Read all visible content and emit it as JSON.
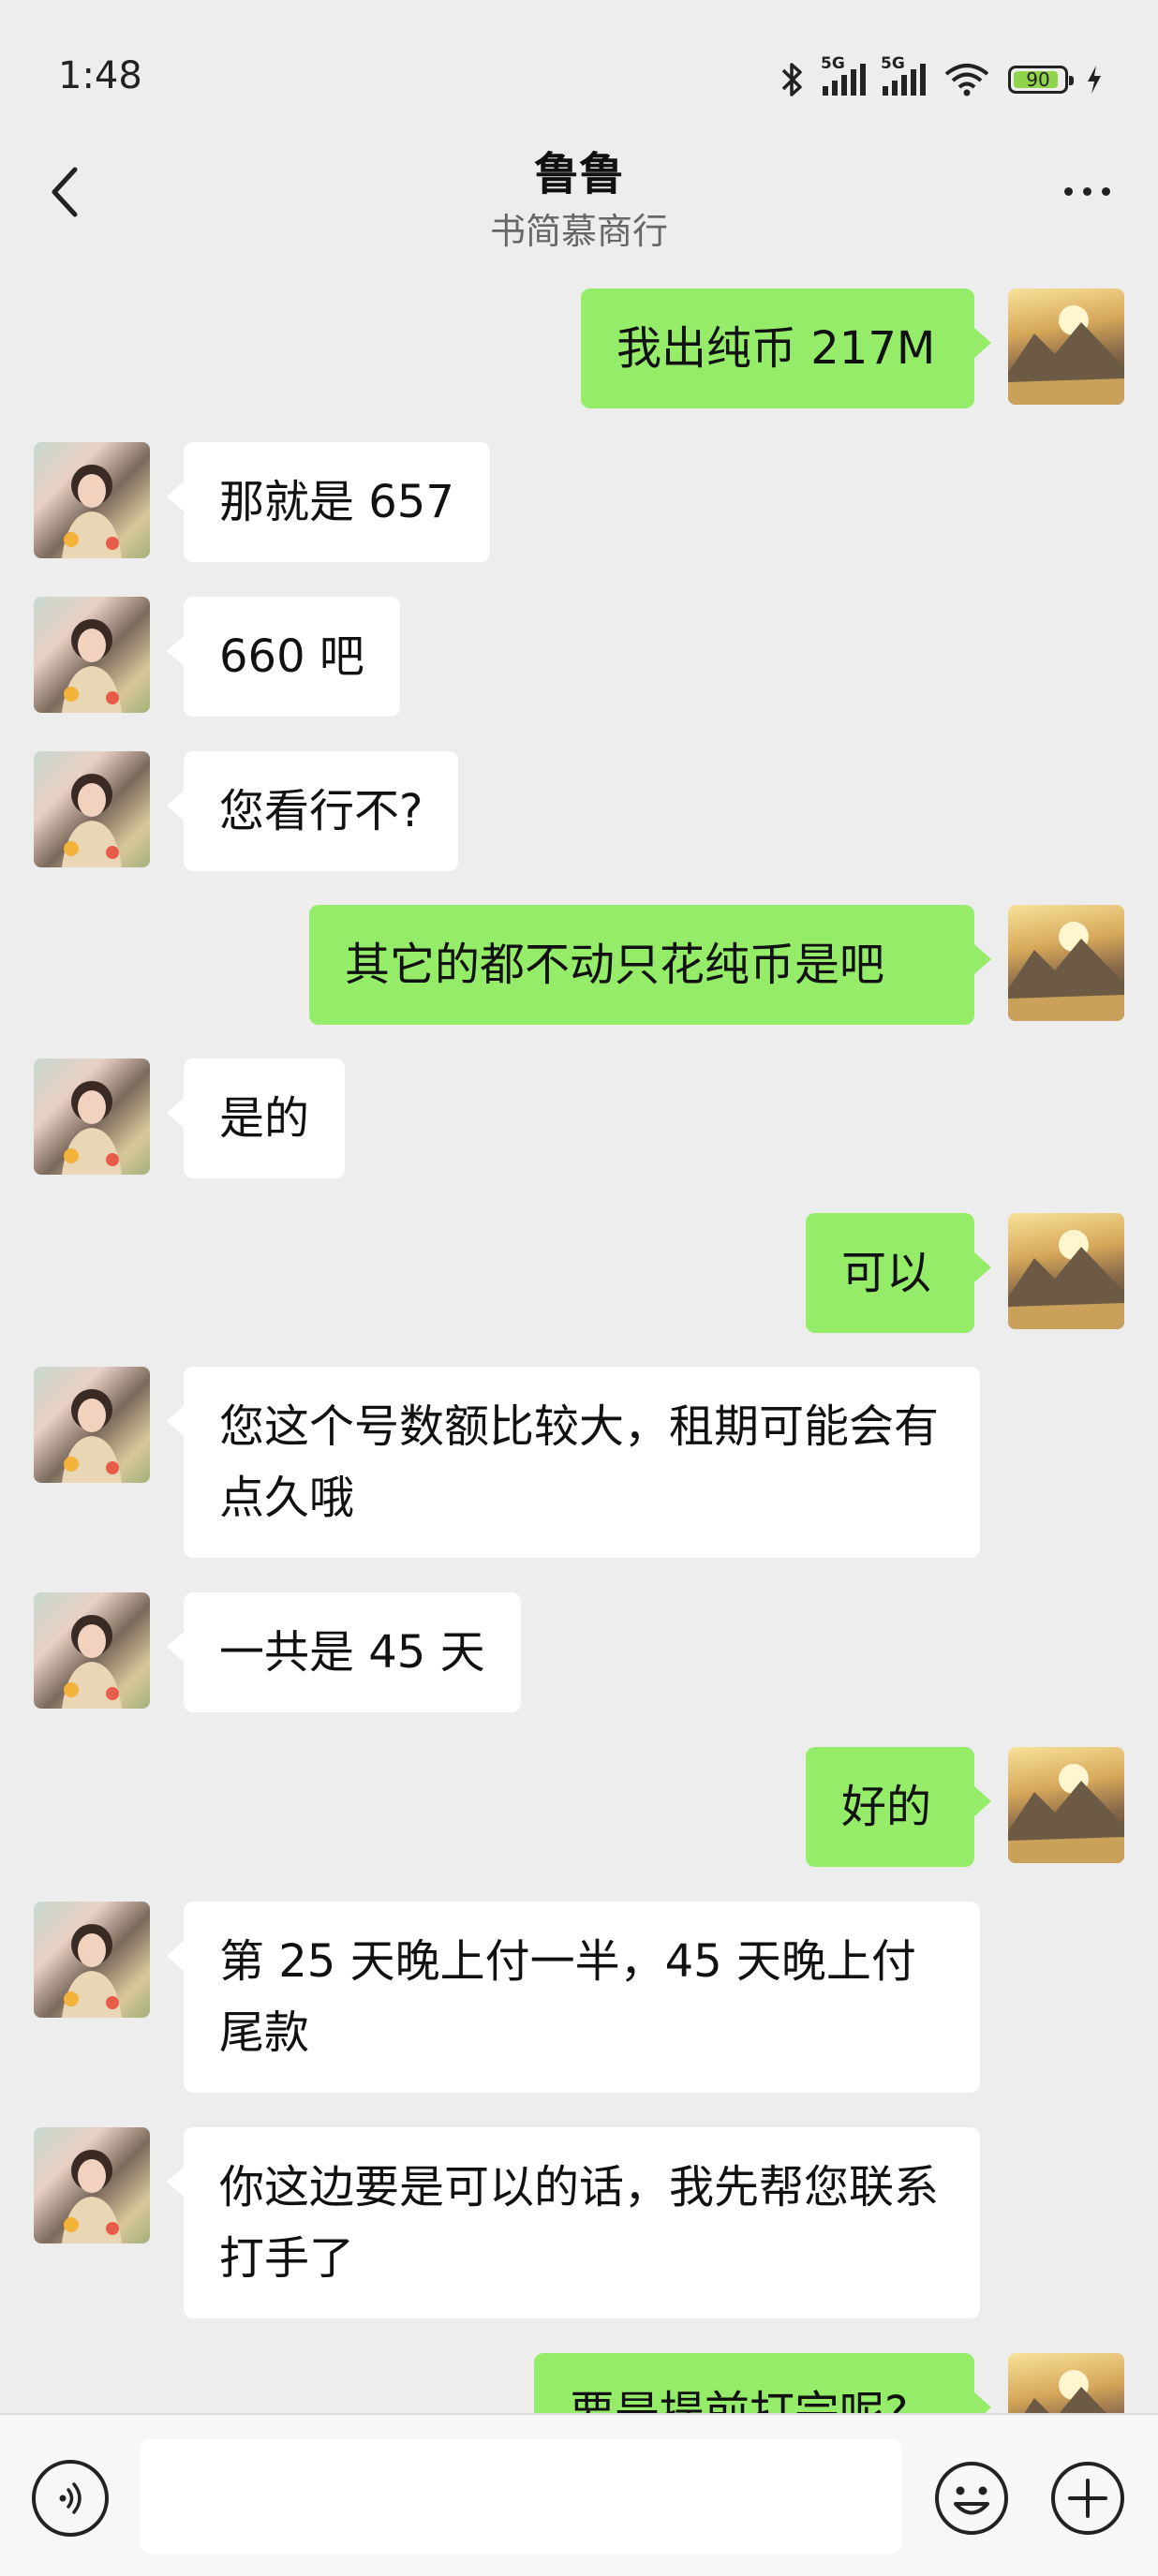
{
  "status": {
    "time": "1:48",
    "network1": "5G",
    "network2": "5G",
    "battery": "90",
    "battery_level": 0.9
  },
  "header": {
    "title": "鲁鲁",
    "subtitle": "书简慕商行"
  },
  "messages": [
    {
      "side": "out",
      "text": "我出纯币 217M"
    },
    {
      "side": "in",
      "text": "那就是 657"
    },
    {
      "side": "in",
      "text": "660 吧"
    },
    {
      "side": "in",
      "text": "您看行不?"
    },
    {
      "side": "out",
      "text": "其它的都不动只花纯币是吧"
    },
    {
      "side": "in",
      "text": "是的"
    },
    {
      "side": "out",
      "text": "可以"
    },
    {
      "side": "in",
      "text": "您这个号数额比较大，租期可能会有点久哦"
    },
    {
      "side": "in",
      "text": "一共是 45 天"
    },
    {
      "side": "out",
      "text": "好的"
    },
    {
      "side": "in",
      "text": "第 25 天晚上付一半，45 天晚上付尾款"
    },
    {
      "side": "in",
      "text": "你这边要是可以的话，我先帮您联系打手了"
    },
    {
      "side": "out",
      "text": "要是提前打完呢?"
    }
  ],
  "input": {
    "value": "",
    "placeholder": ""
  },
  "icons": {
    "back": "chevron-left-icon",
    "more": "more-dots-icon",
    "voice": "voice-icon",
    "emoji": "emoji-icon",
    "plus": "plus-circle-icon"
  },
  "colors": {
    "background": "#ededed",
    "bubble_out": "#95ec69",
    "bubble_in": "#ffffff"
  }
}
